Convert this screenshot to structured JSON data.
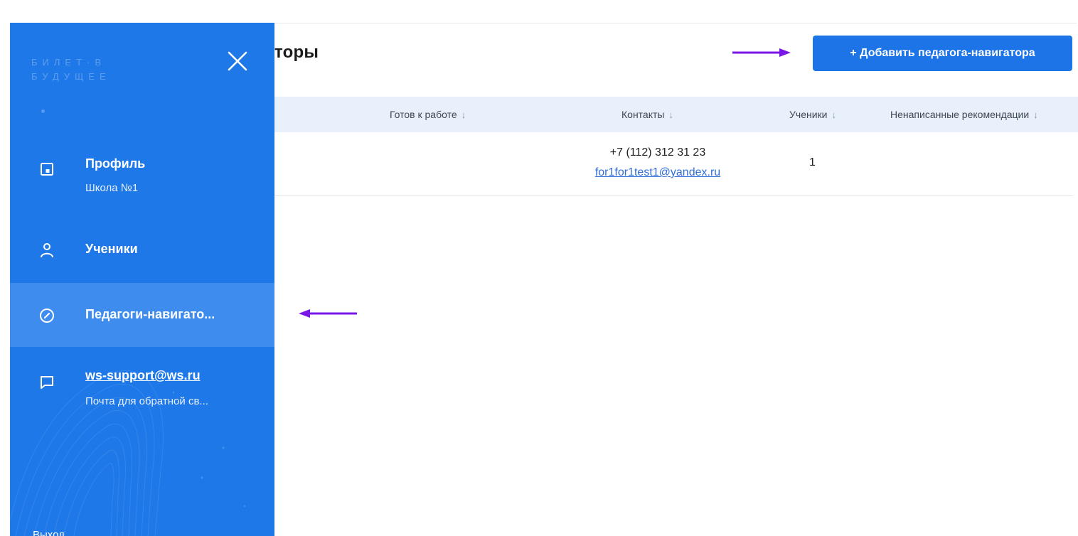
{
  "main": {
    "page_title": "торы",
    "add_button_label": "+ Добавить педагога-навигатора",
    "table": {
      "columns": [
        {
          "label": "Готов к работе",
          "sort_icon": "↓"
        },
        {
          "label": "Контакты",
          "sort_icon": "↓"
        },
        {
          "label": "Ученики",
          "sort_icon": "↓"
        },
        {
          "label": "Ненаписанные рекомендации",
          "sort_icon": "↓"
        }
      ],
      "rows": [
        {
          "phone": "+7 (112) 312 31 23",
          "email": "for1for1test1@yandex.ru",
          "students": "1"
        }
      ]
    }
  },
  "sidebar": {
    "logo_line1": "БИЛЕТ·В",
    "logo_line2": "БУДУЩЕЕ",
    "items": [
      {
        "label": "Профиль",
        "sub": "Школа №1",
        "icon": "profile-icon"
      },
      {
        "label": "Ученики",
        "icon": "user-icon"
      },
      {
        "label": "Педагоги-навигато...",
        "icon": "compass-icon",
        "active": true
      },
      {
        "label": "ws-support@ws.ru",
        "sub": "Почта для обратной св...",
        "icon": "chat-icon"
      }
    ],
    "logout_label": "Выход"
  },
  "colors": {
    "sidebar_bg": "#1e78e8",
    "sidebar_active": "#3e8cee",
    "button_bg": "#1d74e6",
    "table_head_bg": "#e8f1fb",
    "annotation_arrow": "#7a16e6"
  }
}
